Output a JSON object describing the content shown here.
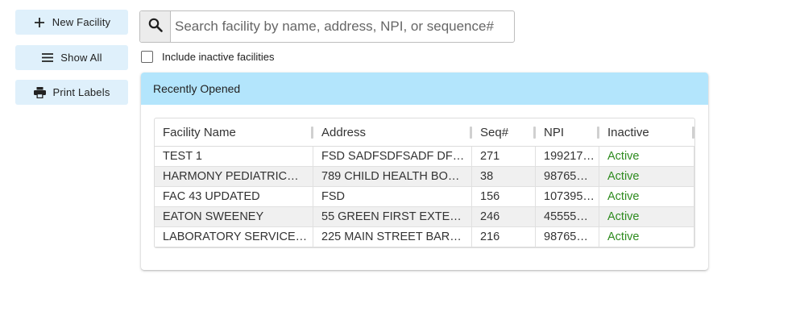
{
  "sidebar": {
    "new_facility": {
      "label": "New Facility",
      "icon": "plus-icon"
    },
    "show_all": {
      "label": "Show All",
      "icon": "list-icon"
    },
    "print_labels": {
      "label": "Print Labels",
      "icon": "printer-icon"
    }
  },
  "search": {
    "placeholder": "Search facility by name, address, NPI, or sequence#",
    "value": "",
    "icon": "search-icon"
  },
  "include_inactive": {
    "label": "Include inactive facilities",
    "checked": false
  },
  "panel": {
    "title": "Recently Opened",
    "header_color": "#b3e5fc"
  },
  "table": {
    "columns": [
      "Facility Name",
      "Address",
      "Seq#",
      "NPI",
      "Inactive"
    ],
    "rows": [
      {
        "name": "TEST 1",
        "address": "FSD SADFSDFSADF DF…",
        "seq": "271",
        "npi": "199217…",
        "status": "Active"
      },
      {
        "name": "HARMONY PEDIATRIC…",
        "address": "789 CHILD HEALTH BO…",
        "seq": "38",
        "npi": "98765…",
        "status": "Active"
      },
      {
        "name": "FAC 43 UPDATED",
        "address": "FSD",
        "seq": "156",
        "npi": "107395…",
        "status": "Active"
      },
      {
        "name": "EATON SWEENEY",
        "address": "55 GREEN FIRST EXTE…",
        "seq": "246",
        "npi": "45555…",
        "status": "Active"
      },
      {
        "name": "LABORATORY SERVICE…",
        "address": "225 MAIN STREET BAR…",
        "seq": "216",
        "npi": "98765…",
        "status": "Active"
      }
    ],
    "status_color": "#2e8b1f"
  }
}
